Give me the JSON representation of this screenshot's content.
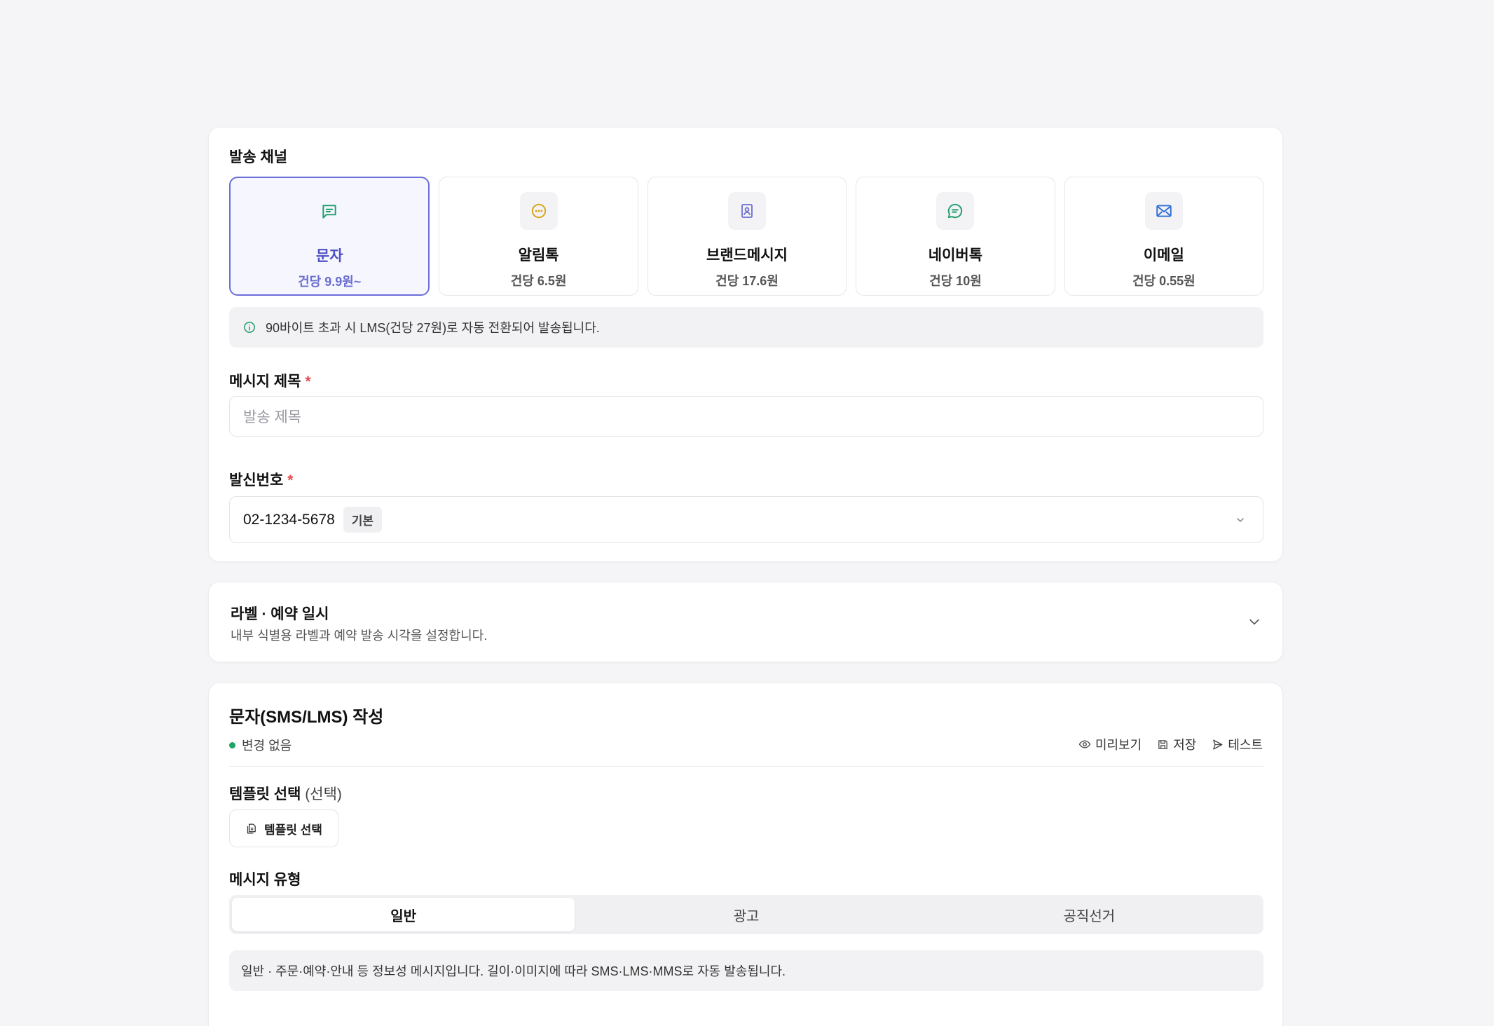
{
  "channel_section": {
    "label": "발송 채널",
    "channels": [
      {
        "name": "문자",
        "price": "건당 9.9원~",
        "icon": "sms-icon",
        "selected": true
      },
      {
        "name": "알림톡",
        "price": "건당 6.5원",
        "icon": "alimtalk-icon",
        "selected": false
      },
      {
        "name": "브랜드메시지",
        "price": "건당 17.6원",
        "icon": "brand-message-icon",
        "selected": false
      },
      {
        "name": "네이버톡",
        "price": "건당 10원",
        "icon": "navertalk-icon",
        "selected": false
      },
      {
        "name": "이메일",
        "price": "건당 0.55원",
        "icon": "email-icon",
        "selected": false
      }
    ],
    "info": "90바이트 초과 시 LMS(건당 27원)로 자동 전환되어 발송됩니다."
  },
  "message_title": {
    "label": "메시지 제목",
    "required_mark": "*",
    "placeholder": "발송 제목"
  },
  "sender": {
    "label": "발신번호",
    "required_mark": "*",
    "value": "02-1234-5678",
    "badge": "기본"
  },
  "label_schedule": {
    "title": "라벨 · 예약 일시",
    "description": "내부 식별용 라벨과 예약 발송 시각을 설정합니다."
  },
  "composer": {
    "title": "문자(SMS/LMS) 작성",
    "status": "변경 없음",
    "actions": {
      "preview": "미리보기",
      "save": "저장",
      "test": "테스트"
    },
    "template": {
      "label": "템플릿 선택",
      "optional": "(선택)",
      "button": "템플릿 선택"
    },
    "message_type": {
      "label": "메시지 유형",
      "options": [
        "일반",
        "광고",
        "공직선거"
      ],
      "selected": "일반",
      "note": "일반 · 주문·예약·안내 등 정보성 메시지입니다. 길이·이미지에 따라 SMS·LMS·MMS로 자동 발송됩니다."
    }
  },
  "colors": {
    "accent": "#6b6fd8",
    "status_green": "#20a464",
    "required_red": "#e5484d"
  }
}
